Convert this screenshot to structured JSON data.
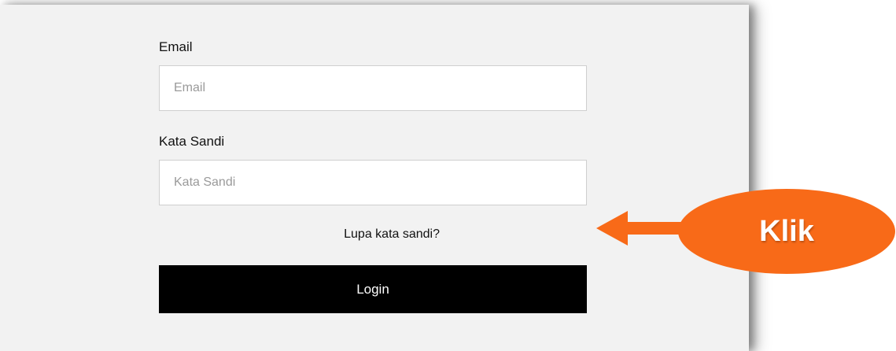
{
  "form": {
    "email_label": "Email",
    "email_placeholder": "Email",
    "email_value": "",
    "password_label": "Kata Sandi",
    "password_placeholder": "Kata Sandi",
    "password_value": "",
    "forgot_label": "Lupa kata sandi?",
    "login_label": "Login"
  },
  "annotation": {
    "callout_text": "Klik",
    "callout_color": "#f86a18",
    "arrow_icon": "left-arrow-icon"
  },
  "colors": {
    "panel_background": "#f2f2f2",
    "button_background": "#000000",
    "button_text": "#ffffff"
  }
}
